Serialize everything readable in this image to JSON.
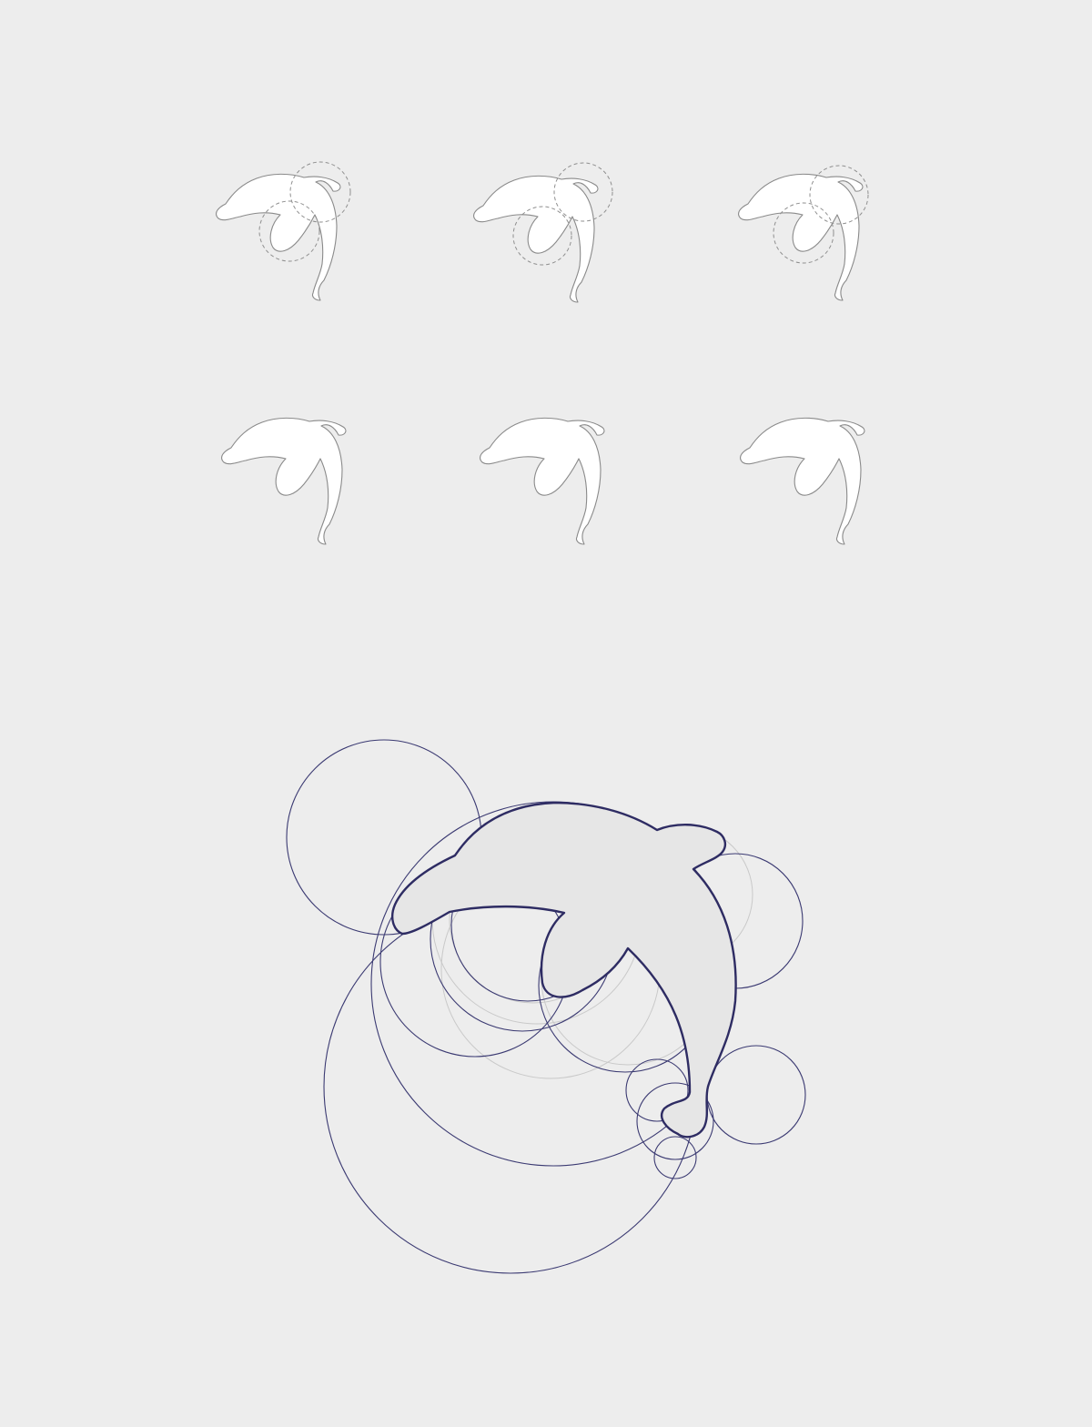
{
  "colors": {
    "background": "#ededed",
    "sketch_fill": "#ffffff",
    "sketch_stroke": "#8a8a8a",
    "grid_stroke": "#3b3a72",
    "mark_fill": "#e6e6e6",
    "mark_stroke": "#2e2c63"
  },
  "sketches": {
    "row_1": {
      "kind": "dolphin outline with dashed guide circles",
      "count": 3
    },
    "row_2": {
      "kind": "dolphin outline variation",
      "count": 3
    }
  },
  "construction": {
    "kind": "dolphin logo construction grid",
    "guide_circles": 17
  }
}
